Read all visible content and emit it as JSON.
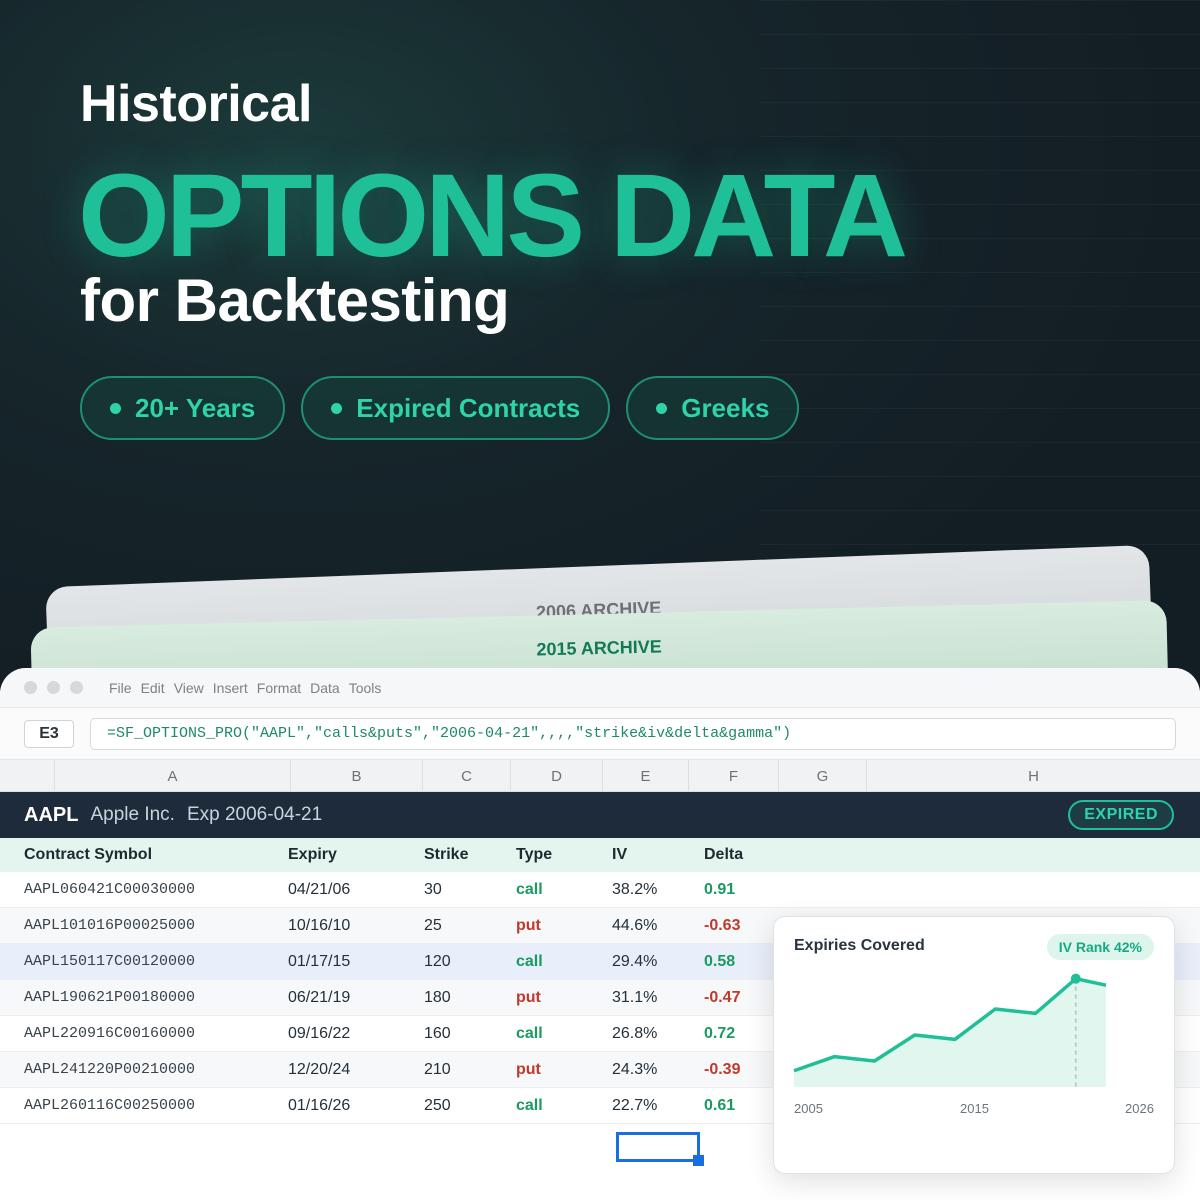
{
  "hero": {
    "line1": "Historical",
    "line2": "OPTIONS DATA",
    "line3": "for Backtesting",
    "pills": [
      "20+ Years",
      "Expired Contracts",
      "Greeks"
    ]
  },
  "archives": {
    "back": "2006 ARCHIVE",
    "front": "2015 ARCHIVE"
  },
  "menu": [
    "File",
    "Edit",
    "View",
    "Insert",
    "Format",
    "Data",
    "Tools"
  ],
  "formula_bar": {
    "cell_ref": "E3",
    "formula": "=SF_OPTIONS_PRO(\"AAPL\",\"calls&puts\",\"2006-04-21\",,,,\"strike&iv&delta&gamma\")"
  },
  "columns": [
    "A",
    "B",
    "C",
    "D",
    "E",
    "F",
    "G",
    "H"
  ],
  "sheet_title": {
    "ticker": "AAPL",
    "company": "Apple Inc.",
    "expiry": "Exp 2006-04-21",
    "status": "EXPIRED"
  },
  "table": {
    "headers": [
      "Contract Symbol",
      "Expiry",
      "Strike",
      "Type",
      "IV",
      "Delta"
    ],
    "rows": [
      {
        "symbol": "AAPL060421C00030000",
        "expiry": "04/21/06",
        "strike": "30",
        "type": "call",
        "iv": "38.2%",
        "delta": "0.91"
      },
      {
        "symbol": "AAPL101016P00025000",
        "expiry": "10/16/10",
        "strike": "25",
        "type": "put",
        "iv": "44.6%",
        "delta": "-0.63"
      },
      {
        "symbol": "AAPL150117C00120000",
        "expiry": "01/17/15",
        "strike": "120",
        "type": "call",
        "iv": "29.4%",
        "delta": "0.58"
      },
      {
        "symbol": "AAPL190621P00180000",
        "expiry": "06/21/19",
        "strike": "180",
        "type": "put",
        "iv": "31.1%",
        "delta": "-0.47"
      },
      {
        "symbol": "AAPL220916C00160000",
        "expiry": "09/16/22",
        "strike": "160",
        "type": "call",
        "iv": "26.8%",
        "delta": "0.72"
      },
      {
        "symbol": "AAPL241220P00210000",
        "expiry": "12/20/24",
        "strike": "210",
        "type": "put",
        "iv": "24.3%",
        "delta": "-0.39"
      },
      {
        "symbol": "AAPL260116C00250000",
        "expiry": "01/16/26",
        "strike": "250",
        "type": "call",
        "iv": "22.7%",
        "delta": "0.61"
      }
    ]
  },
  "chart_card": {
    "title": "Expiries Covered",
    "badge": "IV Rank 42%",
    "x_labels": [
      "2005",
      "2015",
      "2026"
    ]
  },
  "chart_data": {
    "type": "area",
    "title": "Expiries Covered",
    "x": [
      2005,
      2007,
      2009,
      2011,
      2013,
      2015,
      2017,
      2019,
      2021,
      2022.6,
      2024
    ],
    "values": [
      15,
      28,
      24,
      48,
      44,
      72,
      68,
      100,
      94
    ],
    "x_points": [
      2005,
      2007,
      2009,
      2011,
      2013,
      2015,
      2017,
      2019,
      2020.5
    ],
    "xlim": [
      2005,
      2026
    ],
    "ylim": [
      0,
      120
    ],
    "highlight_index": 7,
    "colors": {
      "line": "#1fbf97",
      "fill": "#e1f6ef",
      "highlight_line": "#b8bec2"
    }
  },
  "colors": {
    "accent": "#1fbf97",
    "call": "#1a9a5f",
    "put": "#c0392b",
    "header_bg": "#1e2b3b"
  }
}
